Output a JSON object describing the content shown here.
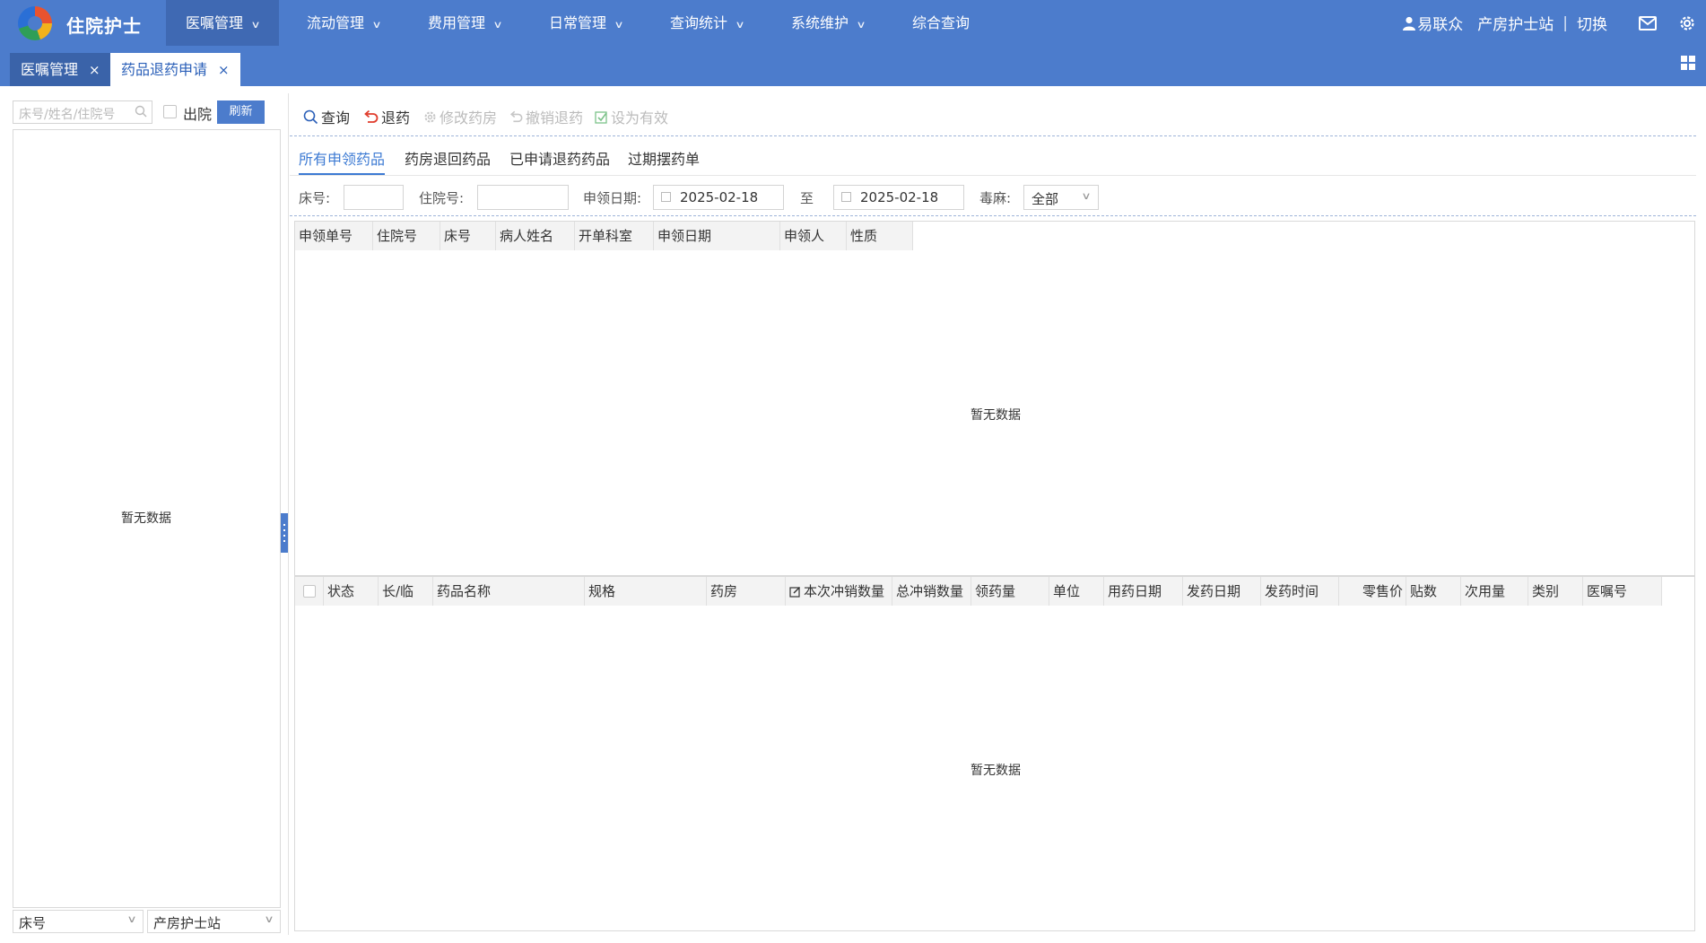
{
  "app": {
    "title": "住院护士"
  },
  "nav": {
    "items": [
      {
        "label": "医嘱管理",
        "active": true
      },
      {
        "label": "流动管理"
      },
      {
        "label": "费用管理"
      },
      {
        "label": "日常管理"
      },
      {
        "label": "查询统计"
      },
      {
        "label": "系统维护"
      },
      {
        "label": "综合查询"
      }
    ]
  },
  "user": {
    "name": "易联众",
    "station": "产房护士站",
    "switch_label": "切换",
    "separator": "|"
  },
  "tabs": [
    {
      "label": "医嘱管理",
      "close": "×"
    },
    {
      "label": "药品退药申请",
      "close": "×"
    }
  ],
  "left": {
    "search_placeholder": "床号/姓名/住院号",
    "discharged_label": "出院",
    "refresh_label": "刷新",
    "empty_text": "暂无数据",
    "sort_select": "床号",
    "station_select": "产房护士站"
  },
  "toolbar": {
    "query": "查询",
    "return_drug": "退药",
    "modify_pharmacy": "修改药房",
    "cancel_return": "撤销退药",
    "set_valid": "设为有效"
  },
  "subtabs": [
    "所有申领药品",
    "药房退回药品",
    "已申请退药药品",
    "过期摆药单"
  ],
  "filters": {
    "bed_label": "床号:",
    "admission_label": "住院号:",
    "date_label": "申领日期:",
    "date_from": "2025-02-18",
    "to_label": "至",
    "date_to": "2025-02-18",
    "narcotic_label": "毒麻:",
    "narcotic_value": "全部"
  },
  "table1": {
    "columns": [
      "申领单号",
      "住院号",
      "床号",
      "病人姓名",
      "开单科室",
      "申领日期",
      "申领人",
      "性质"
    ],
    "empty_text": "暂无数据"
  },
  "table2": {
    "columns": [
      "状态",
      "长/临",
      "药品名称",
      "规格",
      "药房",
      "本次冲销数量",
      "总冲销数量",
      "领药量",
      "单位",
      "用药日期",
      "发药日期",
      "发药时间",
      "零售价",
      "贴数",
      "次用量",
      "类别",
      "医嘱号"
    ],
    "empty_text": "暂无数据"
  }
}
